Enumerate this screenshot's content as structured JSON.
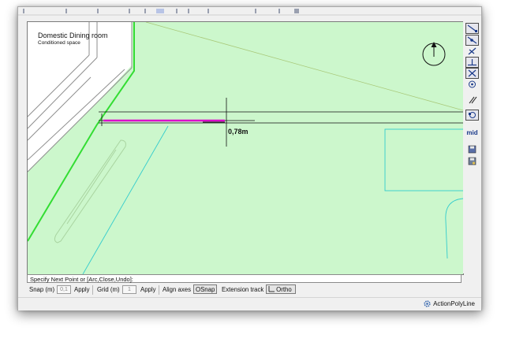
{
  "colors": {
    "canvas_bg": "#ccf7cc",
    "wall_edge": "#33dd33",
    "polyline": "#dd00cc",
    "cyan_lines": "#33cccc"
  },
  "room": {
    "name": "Domestic Dining room",
    "subtitle": "Conditioned space"
  },
  "measurement": "0,78m",
  "command_prompt": "Specify Next Point or [Arc,Close,Undo]:",
  "status": {
    "snap_label": "Snap (m)",
    "snap_value": "0,1",
    "apply1_label": "Apply",
    "grid_label": "Grid (m)",
    "grid_value": "1",
    "apply2_label": "Apply",
    "align_axes_label": "Align axes",
    "osnap_label": "OSnap",
    "extension_track_label": "Extension track",
    "ortho_label": "Ortho"
  },
  "active_action": "ActionPolyLine",
  "toolbar": {
    "mid_label": "mid",
    "icons": [
      "endpoint-snap-icon",
      "nearest-snap-icon",
      "intersection-snap-icon",
      "perpendicular-snap-icon",
      "cross-snap-icon",
      "center-snap-icon",
      "parallel-snap-icon",
      "quadrant-snap-icon",
      "midpoint-snap-icon",
      "floppy-icon",
      "floppy-settings-icon"
    ]
  }
}
